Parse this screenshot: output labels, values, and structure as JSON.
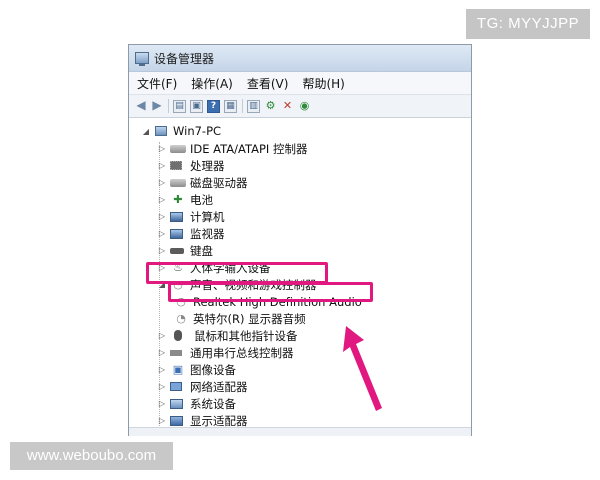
{
  "watermarks": {
    "top_right": "TG: MYYJJPP",
    "bottom_left": "www.weboubo.com"
  },
  "window": {
    "title": "设备管理器",
    "menu": [
      "文件(F)",
      "操作(A)",
      "查看(V)",
      "帮助(H)"
    ]
  },
  "toolbar": {
    "icons": [
      "back-icon",
      "forward-icon",
      "properties-icon",
      "show-hide-icon",
      "help-icon",
      "console-icon",
      "monitor-icon",
      "update-driver-icon",
      "uninstall-icon",
      "scan-changes-icon"
    ]
  },
  "tree": {
    "root": "Win7-PC",
    "items": [
      {
        "label": "IDE ATA/ATAPI 控制器",
        "icon": "ide-controller-icon"
      },
      {
        "label": "处理器",
        "icon": "processor-icon"
      },
      {
        "label": "磁盘驱动器",
        "icon": "disk-drive-icon"
      },
      {
        "label": "电池",
        "icon": "battery-icon"
      },
      {
        "label": "计算机",
        "icon": "computer-icon"
      },
      {
        "label": "监视器",
        "icon": "monitor-icon"
      },
      {
        "label": "键盘",
        "icon": "keyboard-icon"
      },
      {
        "label": "人体学输入设备",
        "icon": "hid-icon"
      },
      {
        "label": "声音、视频和游戏控制器",
        "icon": "sound-icon",
        "expanded": true
      },
      {
        "label": "鼠标和其他指针设备",
        "icon": "mouse-icon"
      },
      {
        "label": "通用串行总线控制器",
        "icon": "usb-icon"
      },
      {
        "label": "图像设备",
        "icon": "imaging-icon"
      },
      {
        "label": "网络适配器",
        "icon": "network-adapter-icon"
      },
      {
        "label": "系统设备",
        "icon": "system-device-icon"
      },
      {
        "label": "显示适配器",
        "icon": "display-adapter-icon"
      }
    ],
    "sound_children": [
      {
        "label": "Realtek High Definition Audio"
      },
      {
        "label": "英特尔(R) 显示器音频"
      }
    ]
  },
  "colors": {
    "highlight": "#e0187f",
    "arrow": "#e0187f"
  }
}
